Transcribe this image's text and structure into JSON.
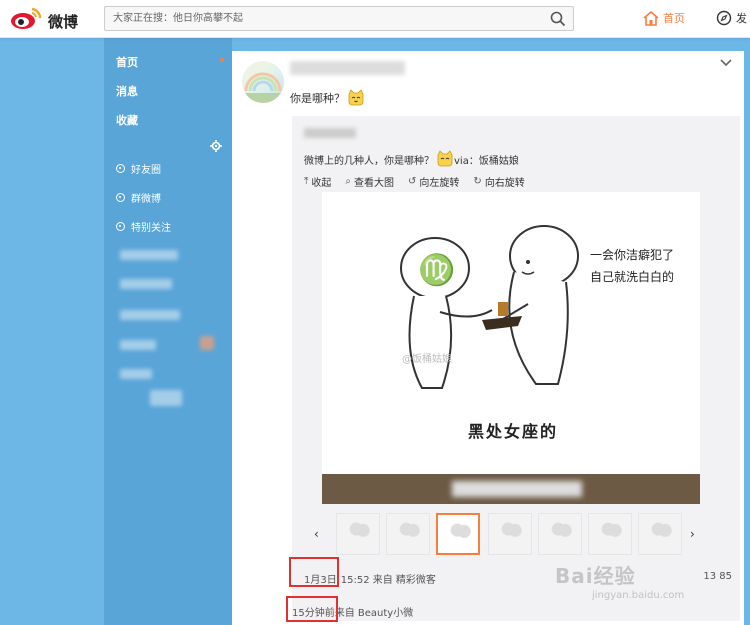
{
  "app": {
    "logo_text": "微博"
  },
  "search": {
    "placeholder": "大家正在搜：他日你高攀不起"
  },
  "topnav": {
    "home_label": "首页",
    "discover_label": "发"
  },
  "sidebar": {
    "items": [
      {
        "label": "首页"
      },
      {
        "label": "消息"
      },
      {
        "label": "收藏"
      }
    ],
    "groups": [
      {
        "label": "好友圈"
      },
      {
        "label": "群微博"
      },
      {
        "label": "特别关注"
      }
    ]
  },
  "post": {
    "text": "你是哪种？",
    "repost": {
      "text": "微博上的几种人，你是哪种？",
      "via": "via：饭桶姑娘",
      "toolbar": [
        {
          "icon": "collapse-icon",
          "label": "收起"
        },
        {
          "icon": "magnifier-icon",
          "label": "查看大图"
        },
        {
          "icon": "rotate-left-icon",
          "label": "向左旋转"
        },
        {
          "icon": "rotate-right-icon",
          "label": "向右旋转"
        }
      ],
      "comic": {
        "speech_line1": "一会你洁癖犯了",
        "speech_line2": "自己就洗白白的",
        "watermark": "@饭桶姑娘",
        "caption": "黑处女座的"
      },
      "date": "1月3日",
      "time_source": "15:52 来自 精彩微客",
      "stats": "13 85"
    },
    "time": "15分钟前",
    "source": "来自 Beauty小微"
  },
  "site_watermark": {
    "main": "Bai经验",
    "sub": "jingyan.baidu.com"
  },
  "colors": {
    "accent": "#fa7d3c",
    "sidebar": "#5aa5d8",
    "background": "#6cb7e6",
    "highlight": "#e03030"
  }
}
